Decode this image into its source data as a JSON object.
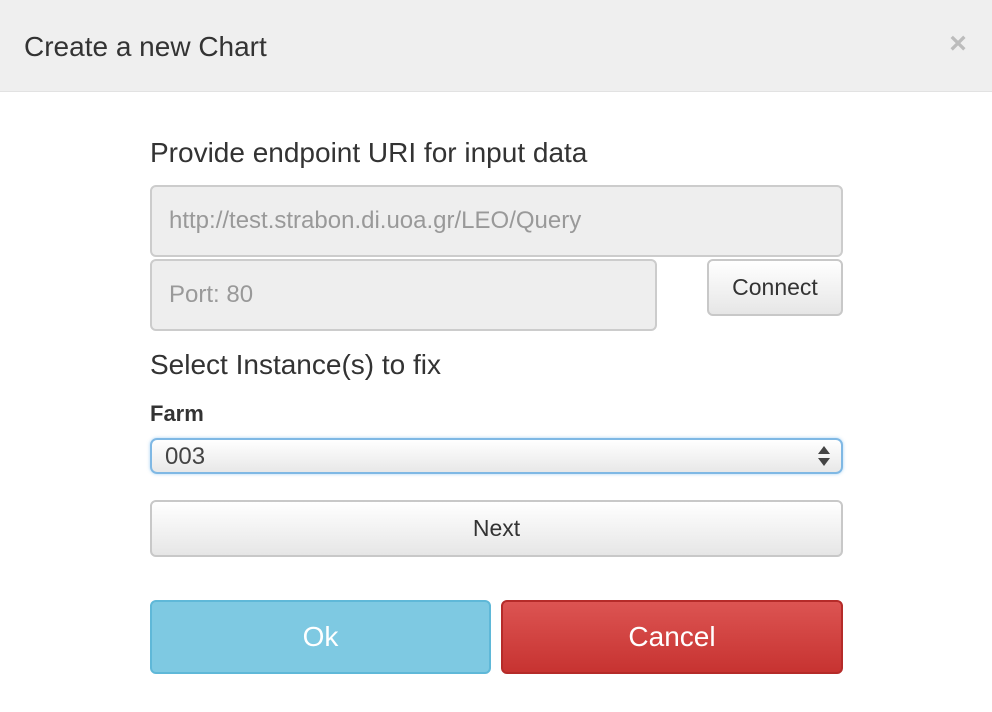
{
  "modal": {
    "title": "Create a new Chart",
    "close_glyph": "×"
  },
  "endpoint": {
    "heading": "Provide endpoint URI for input data",
    "uri_placeholder": "http://test.strabon.di.uoa.gr/LEO/Query",
    "port_placeholder": "Port: 80",
    "connect_label": "Connect"
  },
  "instances": {
    "heading": "Select Instance(s) to fix",
    "farm_label": "Farm",
    "farm_selected": "003",
    "next_label": "Next"
  },
  "footer": {
    "ok_label": "Ok",
    "cancel_label": "Cancel"
  },
  "colors": {
    "ok": "#7ec9e2",
    "cancel": "#d9534f",
    "focus": "#7fb8e4"
  },
  "icons": {
    "close": "close-icon",
    "select_arrows": "select-arrows-icon"
  }
}
